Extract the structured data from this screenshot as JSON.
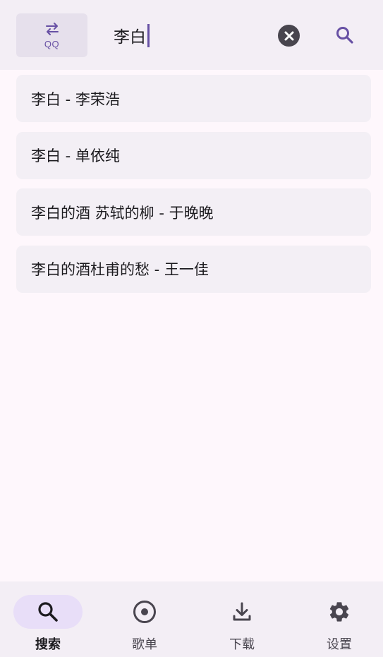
{
  "colors": {
    "accent": "#6750a4",
    "surface": "#f3eef5",
    "pill": "#e8def8",
    "icon_dark": "#48454e"
  },
  "header": {
    "source_button": {
      "icon": "swap-arrows-icon",
      "label": "QQ"
    },
    "search": {
      "value": "李白"
    },
    "clear_icon": "clear-circle-icon",
    "search_icon": "search-icon"
  },
  "suggestions": [
    {
      "text": "李白 - 李荣浩"
    },
    {
      "text": "李白 - 单依纯"
    },
    {
      "text": "李白的酒 苏轼的柳 - 于晚晚"
    },
    {
      "text": "李白的酒杜甫的愁 - 王一佳"
    }
  ],
  "bottom_nav": {
    "active_index": 0,
    "items": [
      {
        "label": "搜索",
        "icon": "search-icon"
      },
      {
        "label": "歌单",
        "icon": "disc-icon"
      },
      {
        "label": "下载",
        "icon": "download-icon"
      },
      {
        "label": "设置",
        "icon": "gear-icon"
      }
    ]
  }
}
